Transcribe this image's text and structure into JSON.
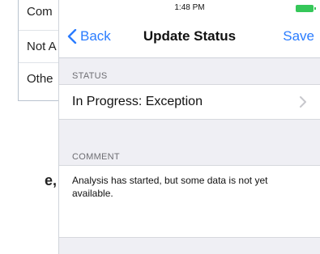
{
  "background": {
    "rows": [
      "Com",
      "Not A",
      "Othe"
    ],
    "fragment": "e,"
  },
  "status_bar": {
    "time": "1:48 PM"
  },
  "nav": {
    "back_label": "Back",
    "title": "Update Status",
    "save_label": "Save"
  },
  "status_section": {
    "header": "STATUS",
    "value": "In Progress: Exception"
  },
  "comment_section": {
    "header": "COMMENT",
    "text": "Analysis has started, but some data is not yet available."
  },
  "colors": {
    "accent": "#2a7cff",
    "battery": "#35c759"
  },
  "icons": [
    "chevron-left-icon",
    "chevron-right-icon",
    "battery-icon"
  ]
}
